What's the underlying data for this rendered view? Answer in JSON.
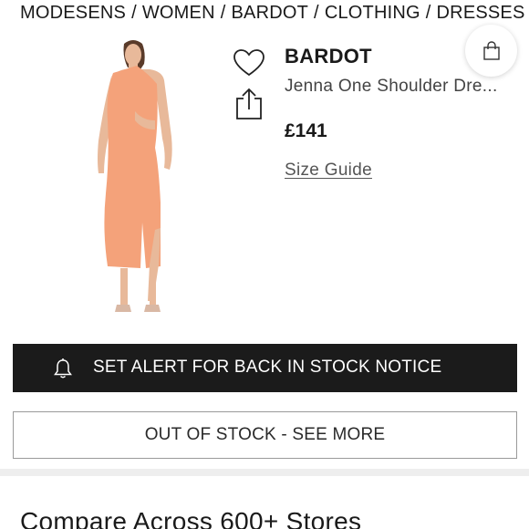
{
  "breadcrumb": {
    "items": [
      "MODESENS",
      "WOMEN",
      "BARDOT",
      "CLOTHING",
      "DRESSES"
    ],
    "separator": "/"
  },
  "icons": {
    "bag": "shopping-bag-icon",
    "favorite": "heart-icon",
    "share": "share-icon",
    "alert": "bell-icon"
  },
  "product": {
    "brand": "BARDOT",
    "name": "Jenna One Shoulder Dre...",
    "price": "£141",
    "size_guide": "Size Guide",
    "image_color": "#f4a27a"
  },
  "actions": {
    "alert_label": "SET ALERT FOR BACK IN STOCK NOTICE",
    "out_of_stock_label": "OUT OF STOCK - SEE MORE"
  },
  "compare": {
    "title": "Compare Across 600+ Stores"
  },
  "colors": {
    "dark_button": "#1b1b1b",
    "text": "#1a1a1a"
  }
}
